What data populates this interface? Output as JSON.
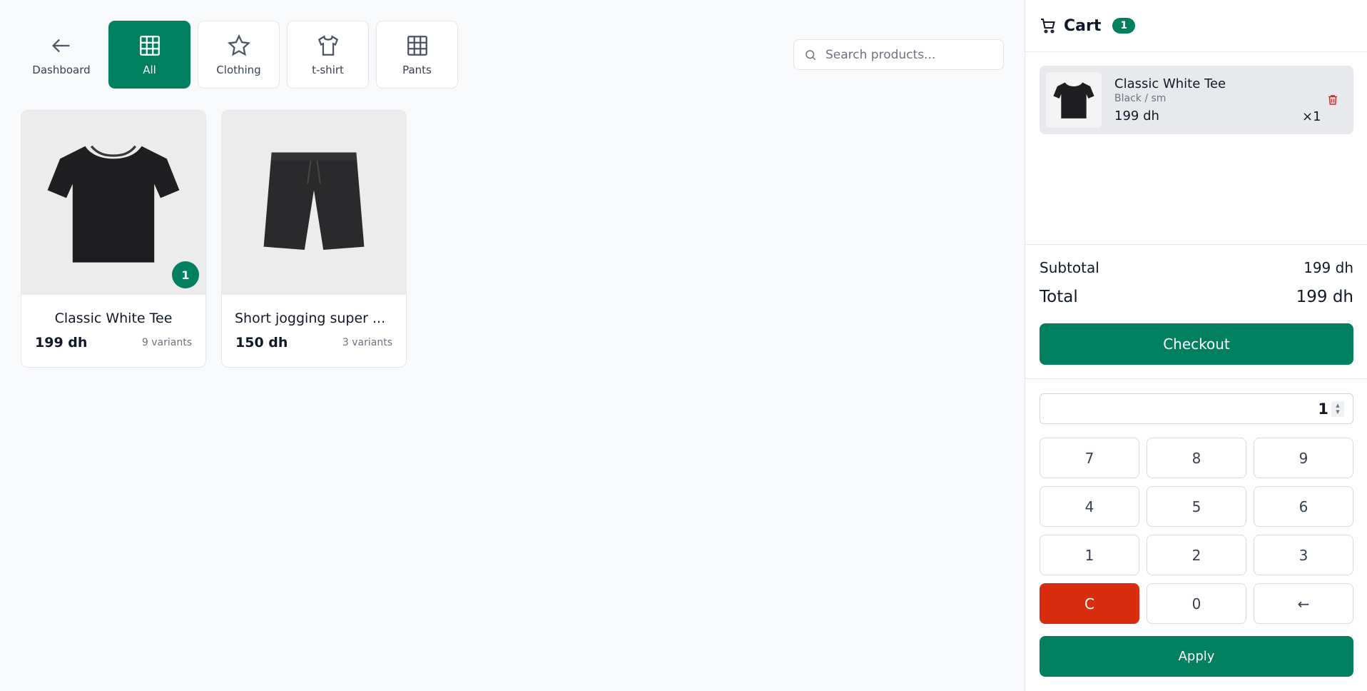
{
  "colors": {
    "accent": "#00805f",
    "clear": "#d92d0f",
    "delete": "#dc2626",
    "background": "#f8f9fb"
  },
  "nav": {
    "back_label": "Dashboard",
    "categories": [
      {
        "label": "All",
        "icon": "grid-icon",
        "active": true
      },
      {
        "label": "Clothing",
        "icon": "star-icon",
        "active": false
      },
      {
        "label": "t-shirt",
        "icon": "shirt-icon",
        "active": false
      },
      {
        "label": "Pants",
        "icon": "grid-icon",
        "active": false
      }
    ]
  },
  "search": {
    "placeholder": "Search products...",
    "value": ""
  },
  "products": [
    {
      "name": "Classic White Tee",
      "price": "199 dh",
      "variants": "9 variants",
      "in_cart": "1",
      "image": "black-tshirt"
    },
    {
      "name": "Short jogging super ...",
      "price": "150 dh",
      "variants": "3 variants",
      "image": "black-shorts"
    }
  ],
  "cart": {
    "title": "Cart",
    "count": "1",
    "items": [
      {
        "name": "Classic White Tee",
        "variant": "Black / sm",
        "price": "199 dh",
        "qty": "×1"
      }
    ],
    "subtotal_label": "Subtotal",
    "subtotal_value": "199 dh",
    "total_label": "Total",
    "total_value": "199 dh",
    "checkout_label": "Checkout"
  },
  "keypad": {
    "value": "1",
    "keys": [
      "7",
      "8",
      "9",
      "4",
      "5",
      "6",
      "1",
      "2",
      "3",
      "C",
      "0",
      "←"
    ],
    "apply_label": "Apply"
  }
}
